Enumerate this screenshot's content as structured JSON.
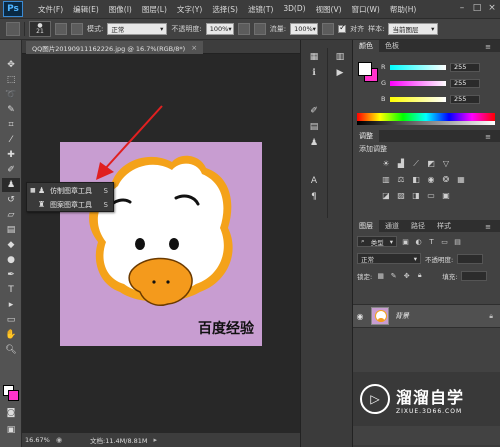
{
  "app": {
    "logo": "Ps"
  },
  "menu": [
    "文件(F)",
    "编辑(E)",
    "图像(I)",
    "图层(L)",
    "文字(Y)",
    "选择(S)",
    "滤镜(T)",
    "3D(D)",
    "视图(V)",
    "窗口(W)",
    "帮助(H)"
  ],
  "window_controls": [
    "–",
    "□",
    "×"
  ],
  "options": {
    "brush_size": "21",
    "mode_label": "模式:",
    "mode_value": "正常",
    "opacity_label": "不透明度:",
    "opacity_value": "100%",
    "flow_label": "流量:",
    "flow_value": "100%",
    "aligned_label": "对齐",
    "aligned_checked": true,
    "sample_label": "样本:",
    "sample_value": "当前图层"
  },
  "document": {
    "tab_title": "QQ图片20190911162226.jpg @ 16.7%(RGB/8*)",
    "close": "×",
    "canvas_color": "#c89dd1",
    "canvas_text": "百度经验"
  },
  "flyout": {
    "items": [
      {
        "label": "仿制图章工具",
        "key": "S",
        "selected": true
      },
      {
        "label": "图案图章工具",
        "key": "S",
        "selected": false
      }
    ]
  },
  "status": {
    "zoom": "16.67%",
    "doc_size": "文档:11.4M/8.81M"
  },
  "color_panel": {
    "tabs": [
      "颜色",
      "色板"
    ],
    "channels": [
      {
        "label": "R",
        "value": "255"
      },
      {
        "label": "G",
        "value": "255"
      },
      {
        "label": "B",
        "value": "255"
      }
    ],
    "foreground": "#ffffff",
    "background": "#ff33cc"
  },
  "adjustments": {
    "tab": "调整",
    "title": "添加调整"
  },
  "layers": {
    "tabs": [
      "图层",
      "通道",
      "路径",
      "样式"
    ],
    "kind_filter": "类型",
    "blend_mode": "正常",
    "opacity_label": "不透明度:",
    "lock_label": "锁定:",
    "fill_label": "填充:",
    "layer_name": "背景"
  },
  "watermark": {
    "name": "溜溜自学",
    "url": "ZIXUE.3D66.COM"
  }
}
